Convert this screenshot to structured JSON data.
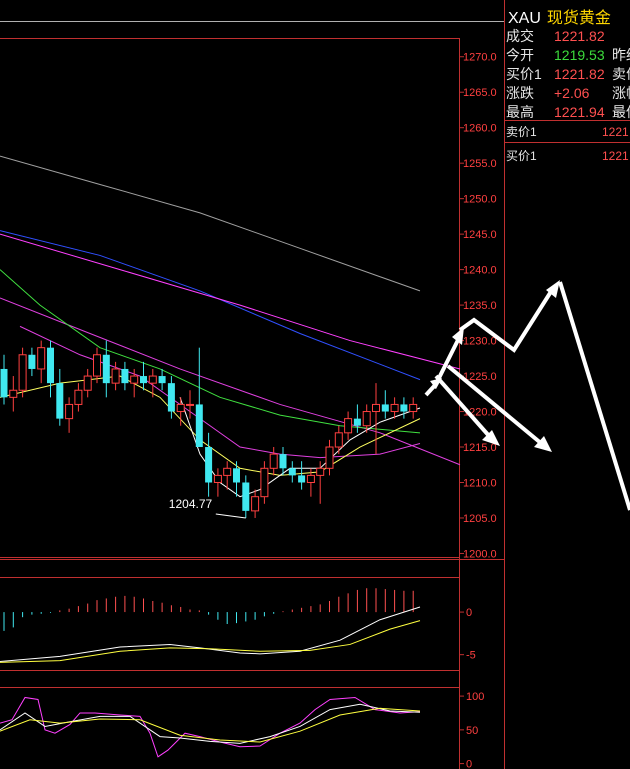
{
  "sidebar": {
    "code": "XAU",
    "name": "现货黄金",
    "rows": [
      {
        "label": "成交",
        "value": "1221.82",
        "color": "#ff5050",
        "label2": ""
      },
      {
        "label": "今开",
        "value": "1219.53",
        "color": "#3cdc3c",
        "label2": "昨结"
      },
      {
        "label": "买价1",
        "value": "1221.82",
        "color": "#ff5050",
        "label2": "卖价"
      },
      {
        "label": "涨跌",
        "value": "+2.06",
        "color": "#ff5050",
        "label2": "涨幅"
      },
      {
        "label": "最高",
        "value": "1221.94",
        "color": "#ff5050",
        "label2": "最低"
      }
    ],
    "orderbook": [
      {
        "label": "卖价1",
        "value": "1221"
      },
      {
        "label": "买价1",
        "value": "1221"
      }
    ]
  },
  "chart_data": [
    {
      "type": "candlestick",
      "yticks": [
        "1270.0",
        "1265.0",
        "1260.0",
        "1255.0",
        "1250.0",
        "1245.0",
        "1240.0",
        "1235.0",
        "1230.0",
        "1225.0",
        "1220.0",
        "1215.0",
        "1210.0",
        "1205.0",
        "1200.0"
      ],
      "ylim": [
        1199.5,
        1272.5
      ],
      "annotation": "1204.77",
      "candles": [
        [
          1226,
          1228,
          1221,
          1222
        ],
        [
          1222,
          1225,
          1220,
          1223
        ],
        [
          1223,
          1229,
          1222,
          1228
        ],
        [
          1228,
          1229,
          1225,
          1226
        ],
        [
          1226,
          1230,
          1224,
          1229
        ],
        [
          1229,
          1230,
          1222,
          1224
        ],
        [
          1224,
          1226,
          1218,
          1219
        ],
        [
          1219,
          1222,
          1217,
          1221
        ],
        [
          1221,
          1224,
          1220,
          1223
        ],
        [
          1223,
          1226,
          1222,
          1225
        ],
        [
          1225,
          1229,
          1224,
          1228
        ],
        [
          1228,
          1230,
          1222,
          1224
        ],
        [
          1224,
          1227,
          1223,
          1226
        ],
        [
          1226,
          1227,
          1223,
          1224
        ],
        [
          1224,
          1226,
          1222,
          1225
        ],
        [
          1225,
          1227,
          1223,
          1224
        ],
        [
          1224,
          1226,
          1222,
          1225
        ],
        [
          1225,
          1226,
          1223,
          1224
        ],
        [
          1224,
          1225,
          1219,
          1220
        ],
        [
          1220,
          1222,
          1218,
          1221
        ],
        [
          1221,
          1223,
          1219,
          1221
        ],
        [
          1221,
          1229,
          1215,
          1215
        ],
        [
          1215,
          1217,
          1208,
          1210
        ],
        [
          1210,
          1212,
          1208,
          1211
        ],
        [
          1211,
          1213,
          1209,
          1212
        ],
        [
          1212,
          1213,
          1208,
          1210
        ],
        [
          1210,
          1211,
          1205,
          1206
        ],
        [
          1206,
          1209,
          1205,
          1208
        ],
        [
          1208,
          1213,
          1207,
          1212
        ],
        [
          1212,
          1215,
          1211,
          1214
        ],
        [
          1214,
          1215,
          1211,
          1212
        ],
        [
          1212,
          1213,
          1210,
          1211
        ],
        [
          1211,
          1213,
          1209,
          1210
        ],
        [
          1210,
          1212,
          1208,
          1211
        ],
        [
          1211,
          1213,
          1207,
          1212
        ],
        [
          1212,
          1216,
          1211,
          1215
        ],
        [
          1215,
          1218,
          1214,
          1217
        ],
        [
          1217,
          1220,
          1216,
          1219
        ],
        [
          1219,
          1221,
          1217,
          1218
        ],
        [
          1218,
          1221,
          1217,
          1220
        ],
        [
          1220,
          1224,
          1214,
          1221
        ],
        [
          1221,
          1223,
          1219,
          1220
        ],
        [
          1220,
          1222,
          1219,
          1221
        ],
        [
          1221,
          1222,
          1219,
          1220
        ],
        [
          1220,
          1222,
          1219,
          1221
        ]
      ],
      "ma_lines": [
        {
          "color": "#a0a0a0",
          "points": [
            [
              0,
              1256
            ],
            [
              100,
              1252
            ],
            [
              200,
              1248
            ],
            [
              300,
              1243
            ],
            [
              420,
              1237
            ]
          ]
        },
        {
          "color": "#3050ff",
          "points": [
            [
              0,
              1245.5
            ],
            [
              100,
              1242
            ],
            [
              200,
              1237
            ],
            [
              300,
              1231
            ],
            [
              420,
              1224.5
            ]
          ]
        },
        {
          "color": "#ff40ff",
          "points": [
            [
              0,
              1245
            ],
            [
              120,
              1240
            ],
            [
              240,
              1235
            ],
            [
              350,
              1230
            ],
            [
              460,
              1226
            ]
          ]
        },
        {
          "color": "#e040e0",
          "points": [
            [
              0,
              1236
            ],
            [
              90,
              1231
            ],
            [
              180,
              1226
            ],
            [
              280,
              1221
            ],
            [
              380,
              1217
            ],
            [
              460,
              1212.5
            ]
          ]
        },
        {
          "color": "#40e040",
          "points": [
            [
              0,
              1240
            ],
            [
              40,
              1235
            ],
            [
              100,
              1229
            ],
            [
              160,
              1226
            ],
            [
              220,
              1222
            ],
            [
              280,
              1219.5
            ],
            [
              340,
              1218
            ],
            [
              420,
              1217
            ]
          ]
        },
        {
          "color": "#e040e0",
          "points": [
            [
              20,
              1232
            ],
            [
              80,
              1228
            ],
            [
              140,
              1225
            ],
            [
              200,
              1219
            ],
            [
              240,
              1215
            ],
            [
              280,
              1214
            ],
            [
              320,
              1213.5
            ],
            [
              380,
              1214
            ],
            [
              420,
              1215.5
            ]
          ]
        },
        {
          "color": "#ffff60",
          "points": [
            [
              0,
              1222
            ],
            [
              60,
              1224
            ],
            [
              120,
              1225
            ],
            [
              160,
              1222
            ],
            [
              200,
              1216
            ],
            [
              240,
              1212
            ],
            [
              280,
              1211
            ],
            [
              320,
              1211.5
            ],
            [
              360,
              1215
            ],
            [
              420,
              1219
            ]
          ]
        },
        {
          "color": "#ffffff",
          "points": [
            [
              180,
              1222
            ],
            [
              200,
              1214
            ],
            [
              220,
              1210
            ],
            [
              240,
              1208
            ],
            [
              260,
              1209
            ],
            [
              290,
              1212
            ],
            [
              320,
              1212
            ],
            [
              350,
              1216
            ],
            [
              380,
              1218.5
            ],
            [
              420,
              1220.5
            ]
          ]
        }
      ]
    },
    {
      "type": "bar",
      "yticks": [
        "0",
        "-5"
      ],
      "ylim": [
        -6.8,
        4
      ],
      "values": [
        -2.2,
        -1.8,
        -0.6,
        -0.3,
        -0.2,
        -0.1,
        0.2,
        0.4,
        0.7,
        1.0,
        1.4,
        1.6,
        1.8,
        1.9,
        1.8,
        1.6,
        1.3,
        1.1,
        0.8,
        0.6,
        0.3,
        0.2,
        -0.3,
        -0.9,
        -1.4,
        -1.3,
        -1.1,
        -0.9,
        -0.5,
        -0.2,
        0.1,
        0.3,
        0.5,
        0.7,
        0.9,
        1.3,
        1.8,
        2.2,
        2.6,
        2.8,
        2.8,
        2.7,
        2.6,
        2.5,
        2.5
      ],
      "lines": [
        {
          "color": "#ffffff",
          "points": [
            [
              0,
              -5.8
            ],
            [
              60,
              -5.2
            ],
            [
              120,
              -4.1
            ],
            [
              170,
              -3.8
            ],
            [
              200,
              -4.2
            ],
            [
              240,
              -4.8
            ],
            [
              260,
              -4.9
            ],
            [
              300,
              -4.6
            ],
            [
              340,
              -3.3
            ],
            [
              380,
              -0.9
            ],
            [
              420,
              0.6
            ]
          ]
        },
        {
          "color": "#ffff40",
          "points": [
            [
              0,
              -5.9
            ],
            [
              60,
              -5.7
            ],
            [
              120,
              -4.6
            ],
            [
              170,
              -4.2
            ],
            [
              210,
              -4.3
            ],
            [
              260,
              -4.6
            ],
            [
              310,
              -4.5
            ],
            [
              350,
              -3.8
            ],
            [
              390,
              -2.0
            ],
            [
              420,
              -1.0
            ]
          ]
        }
      ]
    },
    {
      "type": "line",
      "yticks": [
        "100",
        "50",
        "0"
      ],
      "ylim": [
        -8,
        112
      ],
      "lines": [
        {
          "color": "#ff40ff",
          "points": [
            [
              0,
              60
            ],
            [
              12,
              65
            ],
            [
              25,
              98
            ],
            [
              38,
              95
            ],
            [
              45,
              50
            ],
            [
              55,
              45
            ],
            [
              70,
              58
            ],
            [
              80,
              75
            ],
            [
              95,
              75
            ],
            [
              120,
              72
            ],
            [
              140,
              70
            ],
            [
              150,
              45
            ],
            [
              158,
              10
            ],
            [
              168,
              20
            ],
            [
              185,
              45
            ],
            [
              200,
              40
            ],
            [
              220,
              32
            ],
            [
              240,
              25
            ],
            [
              260,
              26
            ],
            [
              280,
              45
            ],
            [
              300,
              60
            ],
            [
              315,
              80
            ],
            [
              330,
              95
            ],
            [
              355,
              98
            ],
            [
              375,
              80
            ],
            [
              400,
              75
            ],
            [
              420,
              77
            ]
          ]
        },
        {
          "color": "#ffffff",
          "points": [
            [
              0,
              50
            ],
            [
              25,
              75
            ],
            [
              45,
              55
            ],
            [
              70,
              62
            ],
            [
              100,
              70
            ],
            [
              130,
              70
            ],
            [
              160,
              40
            ],
            [
              180,
              38
            ],
            [
              210,
              33
            ],
            [
              240,
              30
            ],
            [
              270,
              40
            ],
            [
              300,
              55
            ],
            [
              330,
              80
            ],
            [
              360,
              88
            ],
            [
              390,
              78
            ],
            [
              420,
              76
            ]
          ]
        },
        {
          "color": "#ffff40",
          "points": [
            [
              0,
              48
            ],
            [
              30,
              65
            ],
            [
              60,
              60
            ],
            [
              100,
              66
            ],
            [
              140,
              65
            ],
            [
              180,
              42
            ],
            [
              220,
              35
            ],
            [
              260,
              32
            ],
            [
              300,
              48
            ],
            [
              340,
              72
            ],
            [
              380,
              82
            ],
            [
              420,
              78
            ]
          ]
        }
      ]
    }
  ]
}
